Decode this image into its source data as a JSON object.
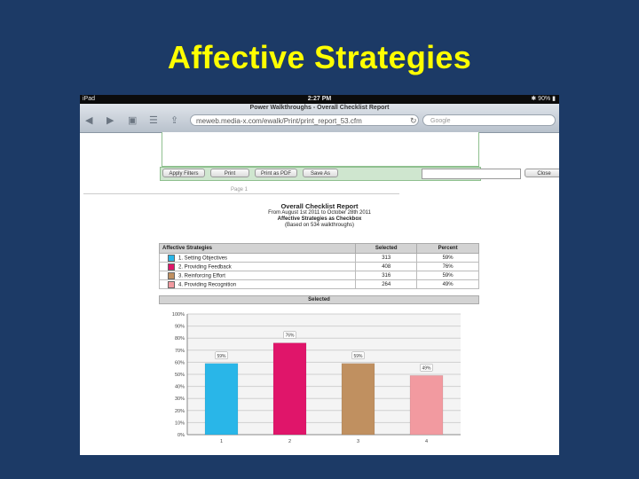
{
  "slide": {
    "title": "Affective Strategies"
  },
  "statusbar": {
    "carrier": "iPad",
    "time": "2:27 PM",
    "battery": "90%"
  },
  "browser": {
    "page_title": "Power Walkthroughs - Overall Checklist Report",
    "url": "meweb.media-x.com/ewalk/Print/print_report_53.cfm",
    "search_placeholder": "Google"
  },
  "toolbar": {
    "apply_filters": "Apply Filters",
    "print": "Print",
    "print_pdf": "Print as PDF",
    "save_as": "Save As",
    "close": "Close"
  },
  "report": {
    "page_label": "Page 1",
    "title": "Overall Checklist Report",
    "date_range": "From August 1st 2011 to October 28th 2011",
    "subtitle": "Affective Strategies as Checkbox",
    "based_on": "(Based on 534 walkthroughs)"
  },
  "table": {
    "headers": [
      "Affective Strategies",
      "Selected",
      "Percent"
    ],
    "rows": [
      {
        "label": "1. Setting Objectives",
        "selected": "313",
        "percent": "59%",
        "color": "#29b6e8"
      },
      {
        "label": "2. Providing Feedback",
        "selected": "408",
        "percent": "76%",
        "color": "#e0156a"
      },
      {
        "label": "3. Reinforcing Effort",
        "selected": "316",
        "percent": "59%",
        "color": "#c09060"
      },
      {
        "label": "4. Providing Recognition",
        "selected": "264",
        "percent": "49%",
        "color": "#f29aa0"
      }
    ]
  },
  "chart_data": {
    "type": "bar",
    "title": "Selected",
    "categories": [
      "1",
      "2",
      "3",
      "4"
    ],
    "values": [
      59,
      76,
      59,
      49
    ],
    "data_labels": [
      "59%",
      "76%",
      "59%",
      "49%"
    ],
    "colors": [
      "#29b6e8",
      "#e0156a",
      "#c09060",
      "#f29aa0"
    ],
    "ylim": [
      0,
      100
    ],
    "yticks": [
      "0%",
      "10%",
      "20%",
      "30%",
      "40%",
      "50%",
      "60%",
      "70%",
      "80%",
      "90%",
      "100%"
    ],
    "grid": true
  }
}
